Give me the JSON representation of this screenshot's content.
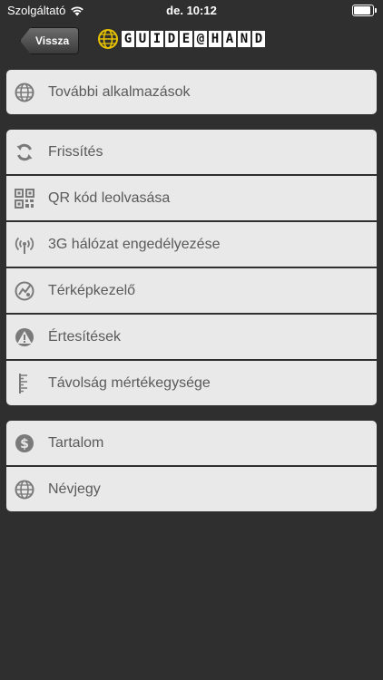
{
  "status": {
    "carrier": "Szolgáltató",
    "time": "de. 10:12"
  },
  "nav": {
    "back_label": "Vissza",
    "logo_letters": [
      "G",
      "U",
      "I",
      "D",
      "E",
      "@",
      "H",
      "A",
      "N",
      "D"
    ]
  },
  "groups": [
    {
      "items": [
        {
          "label": "További alkalmazások",
          "icon": "globe-icon"
        }
      ]
    },
    {
      "items": [
        {
          "label": "Frissítés",
          "icon": "refresh-icon"
        },
        {
          "label": "QR kód leolvasása",
          "icon": "qr-code-icon"
        },
        {
          "label": "3G hálózat engedélyezése",
          "icon": "antenna-icon"
        },
        {
          "label": "Térképkezelő",
          "icon": "map-icon"
        },
        {
          "label": "Értesítések",
          "icon": "warning-icon"
        },
        {
          "label": "Távolság mértékegysége",
          "icon": "ruler-icon"
        }
      ]
    },
    {
      "items": [
        {
          "label": "Tartalom",
          "icon": "dollar-icon"
        },
        {
          "label": "Névjegy",
          "icon": "globe-icon"
        }
      ]
    }
  ],
  "colors": {
    "background": "#2f2f2f",
    "row_background": "#e9e9e9",
    "text": "#5a5a5a",
    "logo_globe": "#e6c200"
  }
}
